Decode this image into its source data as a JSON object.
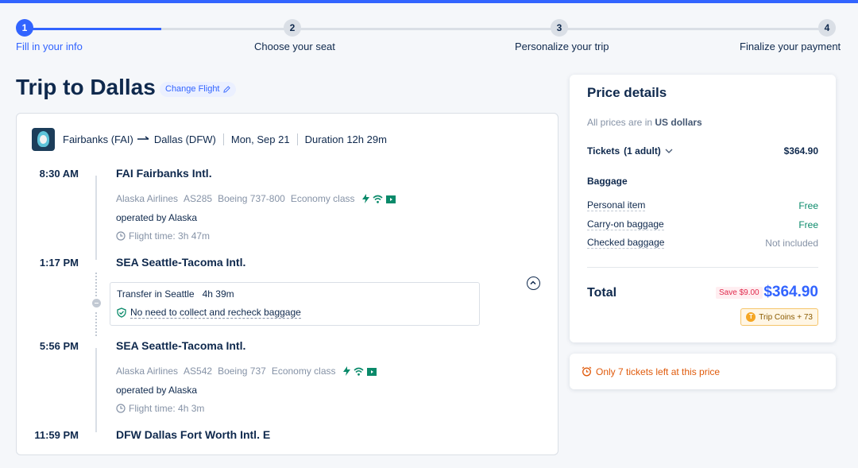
{
  "steps": [
    {
      "num": "1",
      "label": "Fill in your info"
    },
    {
      "num": "2",
      "label": "Choose your seat"
    },
    {
      "num": "3",
      "label": "Personalize your trip"
    },
    {
      "num": "4",
      "label": "Finalize your payment"
    }
  ],
  "progress_fraction": 0.17,
  "trip": {
    "title": "Trip to Dallas",
    "change_flight": "Change Flight"
  },
  "summary": {
    "origin": "Fairbanks (FAI)",
    "destination": "Dallas (DFW)",
    "date": "Mon, Sep 21",
    "duration": "Duration 12h 29m"
  },
  "segments": [
    {
      "depart_time": "8:30 AM",
      "depart_airport": "FAI Fairbanks Intl.",
      "airline": "Alaska Airlines",
      "flight": "AS285",
      "aircraft": "Boeing 737-800",
      "cabin": "Economy class",
      "operated_by": "operated by Alaska",
      "flight_time": "Flight time: 3h 47m",
      "arrive_time": "1:17 PM",
      "arrive_airport": "SEA Seattle-Tacoma Intl."
    },
    {
      "depart_time": "5:56 PM",
      "depart_airport": "SEA Seattle-Tacoma Intl.",
      "airline": "Alaska Airlines",
      "flight": "AS542",
      "aircraft": "Boeing 737",
      "cabin": "Economy class",
      "operated_by": "operated by Alaska",
      "flight_time": "Flight time: 4h 3m",
      "arrive_time": "11:59 PM",
      "arrive_airport": "DFW Dallas Fort Worth Intl. E"
    }
  ],
  "transfer": {
    "text": "Transfer in Seattle",
    "duration": "4h 39m",
    "baggage_note": "No need to collect and recheck baggage"
  },
  "price": {
    "title": "Price details",
    "currency_note_prefix": "All prices are in",
    "currency_note_bold": "US dollars",
    "tickets_label": "Tickets",
    "tickets_count": "(1 adult)",
    "tickets_value": "$364.90",
    "baggage_heading": "Baggage",
    "baggage": [
      {
        "label": "Personal item",
        "value": "Free"
      },
      {
        "label": "Carry-on baggage",
        "value": "Free"
      },
      {
        "label": "Checked baggage",
        "value": "Not included"
      }
    ],
    "total_label": "Total",
    "save": "Save $9.00",
    "total_value": "$364.90",
    "coins": "Trip Coins + 73"
  },
  "alert": "Only 7 tickets left at this price",
  "colors": {
    "accent": "#3264ff",
    "free": "#0a8a6a",
    "warning": "#e05a0b",
    "amenity": "#0a8a6a"
  },
  "icons": [
    "airline-logo",
    "route-arrow-icon",
    "power-icon",
    "wifi-icon",
    "entertainment-icon",
    "clock-icon",
    "shield-check-icon",
    "chevron-down-icon",
    "collapse-icon",
    "edit-icon",
    "alarm-icon",
    "coin-icon"
  ]
}
